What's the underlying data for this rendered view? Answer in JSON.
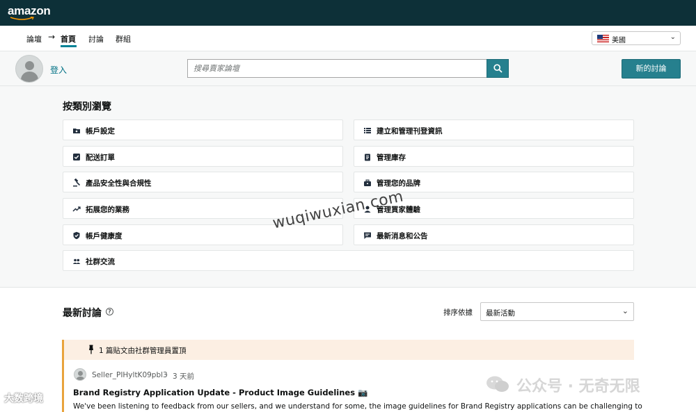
{
  "header": {
    "logo_text": "amazon"
  },
  "nav": {
    "crumbs": [
      "論壇",
      "首頁",
      "討論",
      "群組"
    ],
    "arrow": "→",
    "region": "美國",
    "region_chevron": "⌄"
  },
  "user": {
    "login_label": "登入",
    "search_placeholder": "搜尋賣家論壇",
    "new_discussion_label": "新的討論"
  },
  "browse": {
    "title": "按類別瀏覽",
    "categories": [
      {
        "label": "帳戶設定",
        "icon": "folder-icon"
      },
      {
        "label": "建立和管理刊登資訊",
        "icon": "list-icon"
      },
      {
        "label": "配送訂單",
        "icon": "check-box-icon"
      },
      {
        "label": "管理庫存",
        "icon": "clipboard-icon"
      },
      {
        "label": "產品安全性與合規性",
        "icon": "gavel-icon"
      },
      {
        "label": "管理您的品牌",
        "icon": "briefcase-icon"
      },
      {
        "label": "拓展您的業務",
        "icon": "trending-up-icon"
      },
      {
        "label": "管理買家體驗",
        "icon": "person-icon"
      },
      {
        "label": "帳戶健康度",
        "icon": "shield-check-icon"
      },
      {
        "label": "最新消息和公告",
        "icon": "chat-icon"
      },
      {
        "label": "社群交流",
        "icon": "people-icon"
      }
    ]
  },
  "discussions": {
    "title": "最新討論",
    "help_glyph": "?",
    "sort_label": "排序依據",
    "sort_value": "最新活動",
    "sort_chevron": "⌄",
    "pinned_text": "1 篇貼文由社群管理員置頂",
    "post": {
      "author": "Seller_PIHyltK09pbl3",
      "separator": "·",
      "time": "3 天前",
      "title": "Brand Registry Application Update - Product Image Guidelines 📷",
      "excerpt": "We've been listening to feedback from our sellers, and we understand for some, the image guidelines for Brand Registry applications can be challenging to"
    }
  },
  "watermarks": {
    "center": "wuqiwuxian.com",
    "wechat": "公众号 · 无奇无限",
    "left": "大数跨境"
  },
  "colors": {
    "topbar": "#0d3038",
    "teal_button": "#26808e",
    "link": "#007185",
    "pinned_bg": "#fcefe3",
    "pinned_accent": "#e9a33c"
  }
}
